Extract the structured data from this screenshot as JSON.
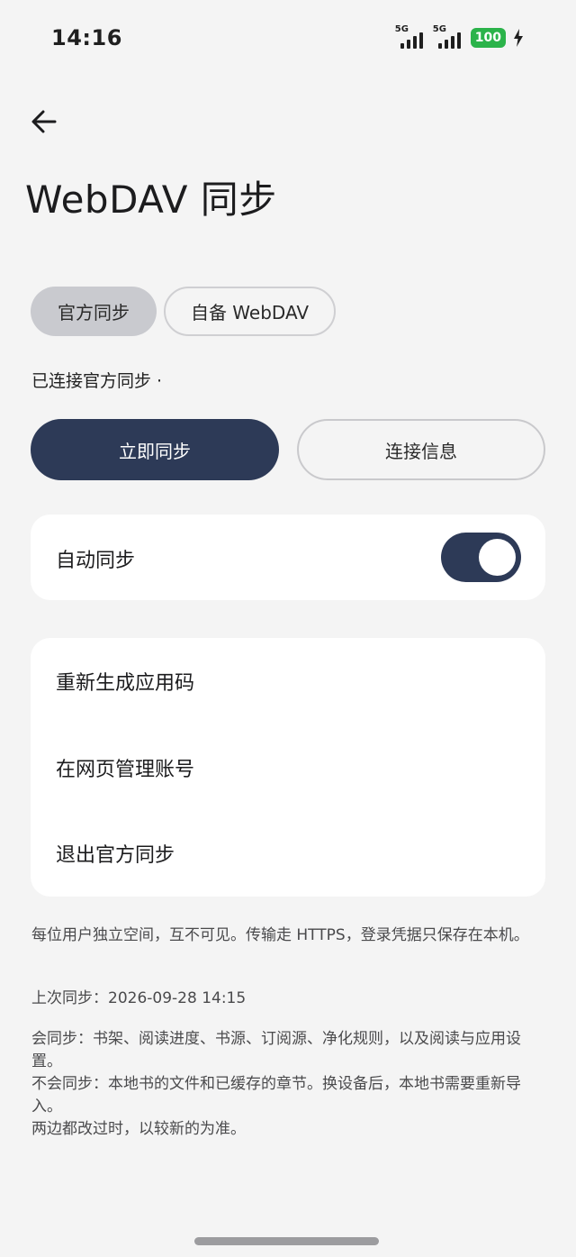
{
  "status_bar": {
    "time": "14:16",
    "signal_1_label": "5G",
    "signal_2_label": "5G",
    "battery": "100",
    "icons": [
      "signal-5g-icon",
      "signal-5g-icon",
      "battery-icon",
      "charging-bolt-icon"
    ],
    "battery_color": "#2bb34a"
  },
  "header": {
    "back_icon": "arrow-left-icon",
    "title": "WebDAV 同步"
  },
  "tabs": [
    {
      "label": "官方同步",
      "selected": true
    },
    {
      "label": "自备 WebDAV",
      "selected": false
    }
  ],
  "connection_status": "已连接官方同步 ·",
  "actions": {
    "sync_now": "立即同步",
    "connection_info": "连接信息"
  },
  "auto_sync": {
    "label": "自动同步",
    "enabled": true
  },
  "menu": [
    {
      "label": "重新生成应用码"
    },
    {
      "label": "在网页管理账号"
    },
    {
      "label": "退出官方同步"
    }
  ],
  "notes": {
    "privacy": "每位用户独立空间，互不可见。传输走 HTTPS，登录凭据只保存在本机。",
    "last_sync": "上次同步：2026-09-28 14:15",
    "scope_synced": "会同步：书架、阅读进度、书源、订阅源、净化规则，以及阅读与应用设置。",
    "scope_not_synced": "不会同步：本地书的文件和已缓存的章节。换设备后，本地书需要重新导入。",
    "conflict_rule": "两边都改过时，以较新的为准。"
  },
  "colors": {
    "accent": "#2d3a57",
    "background": "#f4f4f4",
    "card": "#ffffff",
    "tab_selected": "#c9cacf"
  }
}
